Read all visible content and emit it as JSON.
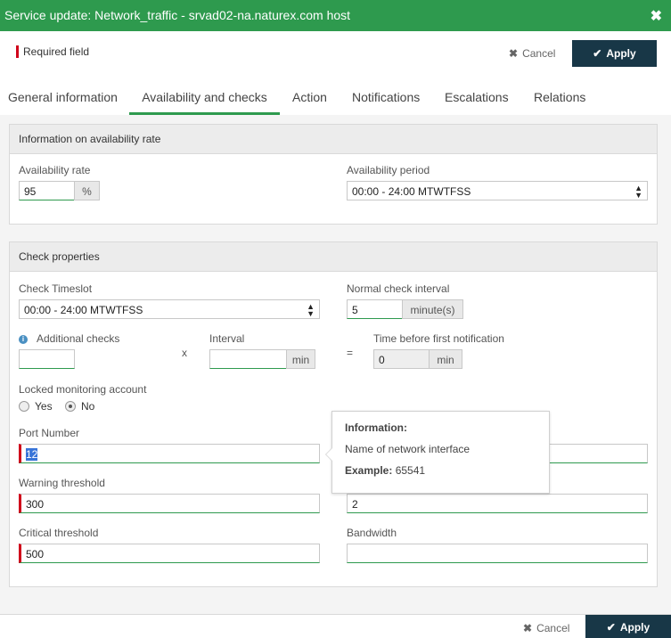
{
  "window": {
    "title": "Service update: Network_traffic - srvad02-na.naturex.com host",
    "close_icon": "close-icon"
  },
  "toolbar": {
    "required_label": "Required field",
    "cancel_label": "Cancel",
    "apply_label": "Apply"
  },
  "tabs": [
    {
      "label": "General information",
      "active": false
    },
    {
      "label": "Availability and checks",
      "active": true
    },
    {
      "label": "Action",
      "active": false
    },
    {
      "label": "Notifications",
      "active": false
    },
    {
      "label": "Escalations",
      "active": false
    },
    {
      "label": "Relations",
      "active": false
    }
  ],
  "availability": {
    "title": "Information on availability rate",
    "rate_label": "Availability rate",
    "rate_value": "95",
    "rate_unit": "%",
    "period_label": "Availability period",
    "period_value": "00:00 - 24:00 MTWTFSS"
  },
  "check": {
    "title": "Check properties",
    "timeslot_label": "Check Timeslot",
    "timeslot_value": "00:00 - 24:00 MTWTFSS",
    "normal_interval_label": "Normal check interval",
    "normal_interval_value": "5",
    "normal_interval_unit": "minute(s)",
    "additional_checks_label": "Additional checks",
    "additional_checks_value": "",
    "times_sign": "x",
    "interval_label": "Interval",
    "interval_value": "",
    "interval_unit": "min",
    "equals_sign": "=",
    "time_before_label": "Time before first notification",
    "time_before_value": "0",
    "time_before_unit": "min",
    "locked_label": "Locked monitoring account",
    "yes_label": "Yes",
    "no_label": "No",
    "locked_selected": "No",
    "port_label": "Port Number",
    "port_value": "12",
    "port_right_value": "",
    "warning_label": "Warning threshold",
    "warning_value": "300",
    "warning_right_value": "2",
    "critical_label": "Critical threshold",
    "critical_value": "500",
    "bandwidth_label": "Bandwidth",
    "bandwidth_value": ""
  },
  "tooltip": {
    "heading": "Information:",
    "text": "Name of network interface",
    "example_label": "Example:",
    "example_value": "65541"
  },
  "footer": {
    "cancel_label": "Cancel",
    "apply_label": "Apply"
  },
  "colors": {
    "title_bar": "#2e9a4e",
    "apply_button": "#183747",
    "required_mark": "#d0021b"
  }
}
